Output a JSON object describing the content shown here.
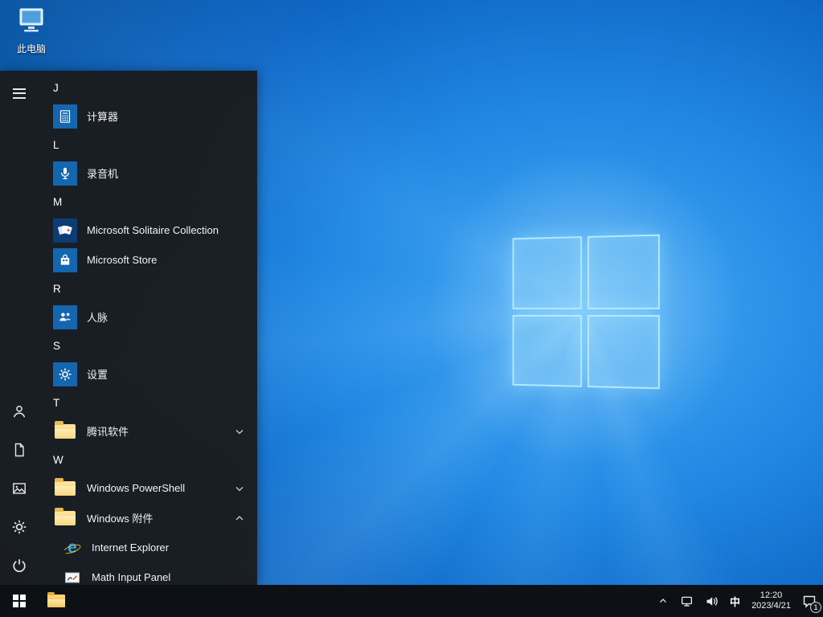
{
  "colors": {
    "accent_blue": "#1466ae",
    "tile_navy": "#0c3c74",
    "folder_yellow": "#f3c966",
    "menu_bg": "#1a1c1f",
    "taskbar_bg": "#0d1014",
    "wallpaper_blue": "#0e66c4"
  },
  "desktop": {
    "this_pc_label": "此电脑"
  },
  "start_menu": {
    "headers": {
      "j": "J",
      "l": "L",
      "m": "M",
      "r": "R",
      "s": "S",
      "t": "T",
      "w": "W"
    },
    "apps": {
      "calculator": "计算器",
      "voice_recorder": "录音机",
      "solitaire": "Microsoft Solitaire Collection",
      "store": "Microsoft Store",
      "people": "人脉",
      "settings": "设置",
      "tencent": "腾讯软件",
      "powershell": "Windows PowerShell",
      "accessories": "Windows 附件",
      "internet_explorer": "Internet Explorer",
      "math_input": "Math Input Panel"
    }
  },
  "taskbar": {
    "ime_indicator": "中",
    "time": "12:20",
    "date": "2023/4/21",
    "notification_count": "1"
  }
}
